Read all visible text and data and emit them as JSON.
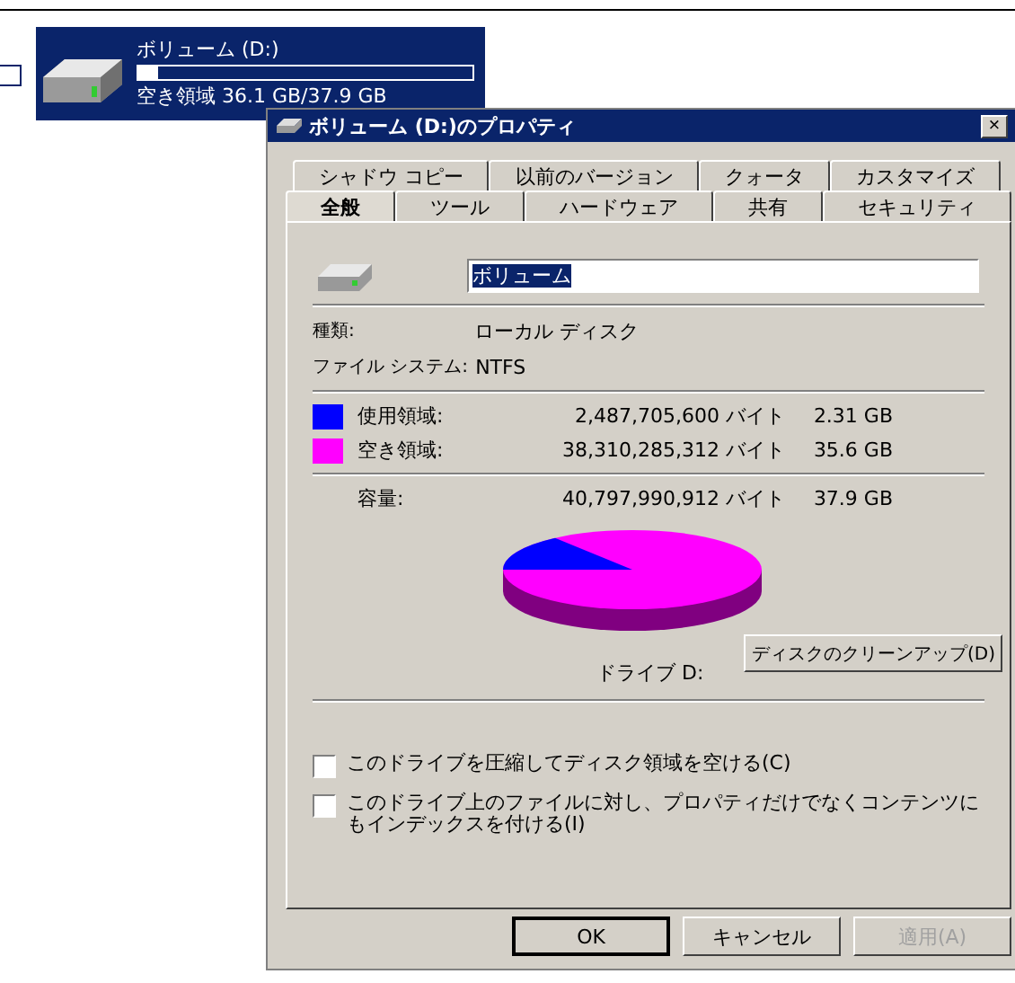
{
  "drive_tile": {
    "name": "ボリューム (D:)",
    "selected": true,
    "level": 0.06,
    "free_text": "空き領域 36.1 GB/37.9 GB"
  },
  "dialog": {
    "title": "ボリューム (D:)のプロパティ",
    "close": "×",
    "tab_rows": [
      [
        {
          "label": "シャドウ コピー",
          "selected": false
        },
        {
          "label": "以前のバージョン",
          "selected": false
        },
        {
          "label": "クォータ",
          "selected": false
        },
        {
          "label": "カスタマイズ",
          "selected": false
        }
      ],
      [
        {
          "label": "全般",
          "selected": true
        },
        {
          "label": "ツール",
          "selected": false
        },
        {
          "label": "ハードウェア",
          "selected": false
        },
        {
          "label": "共有",
          "selected": false
        },
        {
          "label": "セキュリティ",
          "selected": false
        }
      ]
    ],
    "name_field": {
      "value": "ボリューム"
    },
    "info": [
      {
        "label": "種類:",
        "value": "ローカル ディスク"
      },
      {
        "label": "ファイル システム:",
        "value": "NTFS"
      }
    ],
    "space": [
      {
        "label": "使用領域:",
        "color": "#0000ff",
        "bytes": "2,487,705,600 バイト",
        "size": "2.31 GB"
      },
      {
        "label": "空き領域:",
        "color": "#ff00ff",
        "bytes": "38,310,285,312 バイト",
        "size": "35.6 GB"
      }
    ],
    "capacity": {
      "label": "容量:",
      "bytes": "40,797,990,912 バイト",
      "size": "37.9 GB"
    },
    "drive_label": "ドライブ D:",
    "cleanup_button": "ディスクのクリーンアップ(D)",
    "options": [
      {
        "label": "このドライブを圧縮してディスク領域を空ける(C)",
        "checked": false
      },
      {
        "label": "このドライブ上のファイルに対し、プロパティだけでなくコンテンツにもインデックスを付ける(I)",
        "checked": false
      }
    ],
    "buttons": [
      {
        "label": "OK",
        "default": true,
        "disabled": false
      },
      {
        "label": "キャンセル",
        "default": false,
        "disabled": false
      },
      {
        "label": "適用(A)",
        "default": false,
        "disabled": true
      }
    ]
  }
}
